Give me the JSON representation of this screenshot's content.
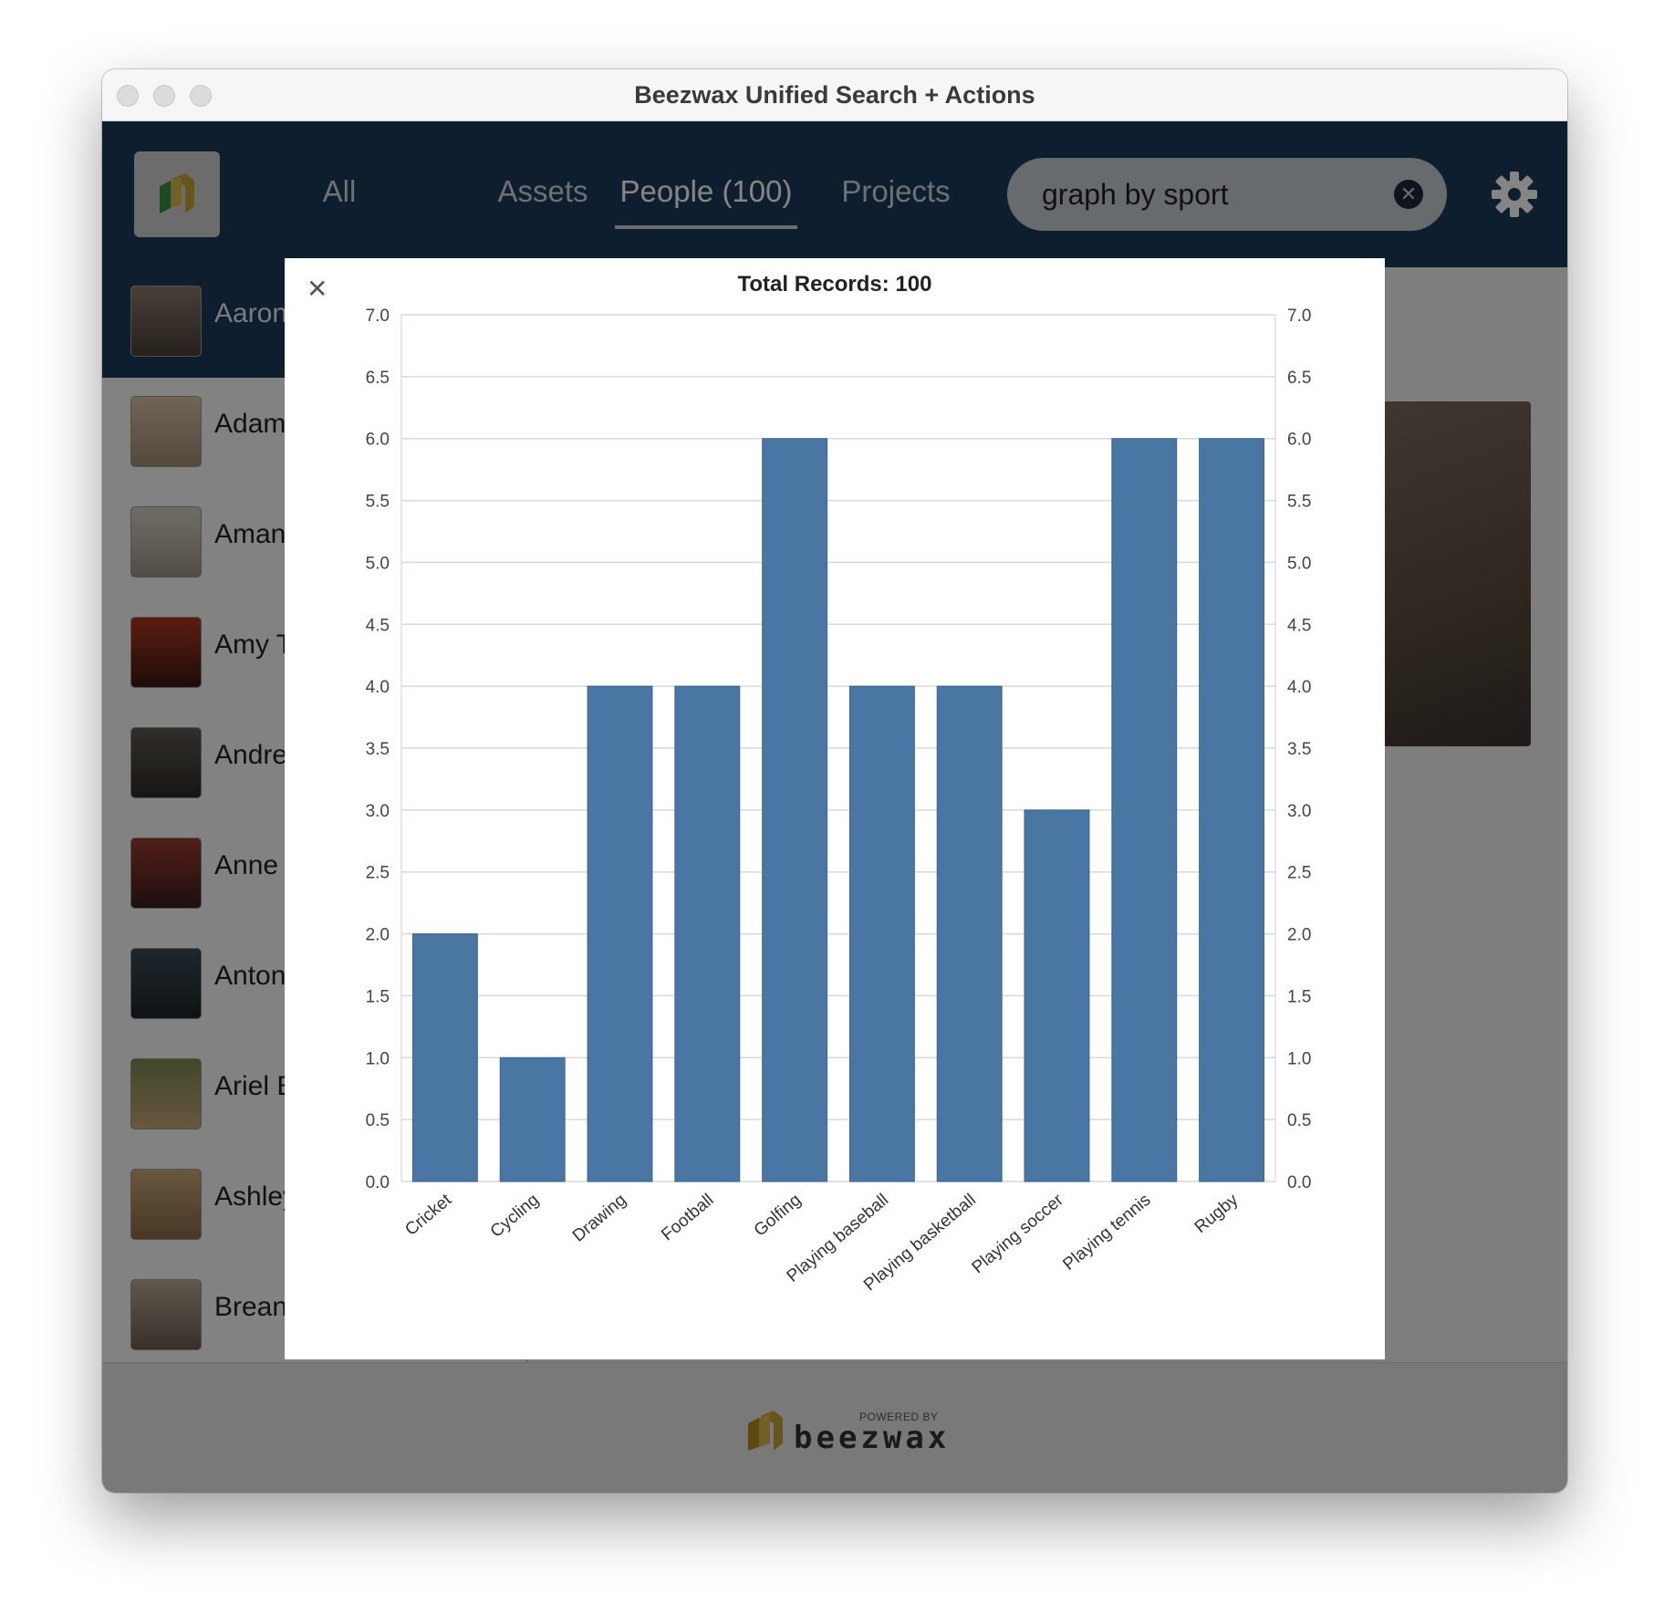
{
  "window": {
    "title": "Beezwax Unified Search + Actions"
  },
  "nav": {
    "tabs": [
      {
        "label": "All"
      },
      {
        "label": "Assets"
      },
      {
        "label": "People (100)"
      },
      {
        "label": "Projects"
      }
    ],
    "active_tab": "People (100)"
  },
  "search": {
    "value": "graph by sport",
    "clear_icon": "close-circle-icon"
  },
  "settings": {
    "icon": "gear-icon"
  },
  "people": [
    {
      "name": "Aaron",
      "selected": true
    },
    {
      "name": "Adam"
    },
    {
      "name": "Amand"
    },
    {
      "name": "Amy T"
    },
    {
      "name": "Andrew"
    },
    {
      "name": "Anne I"
    },
    {
      "name": "Antoni"
    },
    {
      "name": "Ariel B"
    },
    {
      "name": "Ashley"
    },
    {
      "name": "Breanr"
    }
  ],
  "footer": {
    "powered_by": "POWERED BY",
    "brand": "beezwax"
  },
  "colors": {
    "navbar": "#1b3a5a",
    "bar": "#4a76a3",
    "logo_gold": "#c8a43a",
    "logo_green": "#3d8c3d"
  },
  "chart_data": {
    "type": "bar",
    "title": "Total Records: 100",
    "categories": [
      "Cricket",
      "Cycling",
      "Drawing",
      "Football",
      "Golfing",
      "Playing baseball",
      "Playing basketball",
      "Playing soccer",
      "Playing tennis",
      "Rugby"
    ],
    "values": [
      2,
      1,
      4,
      4,
      6,
      4,
      4,
      3,
      6,
      6
    ],
    "ylim": [
      0,
      7
    ],
    "yticks": [
      "0.0",
      "0.5",
      "1.0",
      "1.5",
      "2.0",
      "2.5",
      "3.0",
      "3.5",
      "4.0",
      "4.5",
      "5.0",
      "5.5",
      "6.0",
      "6.5",
      "7.0"
    ],
    "xlabel": "",
    "ylabel": "",
    "grid": true,
    "dual_y_axis": true
  }
}
